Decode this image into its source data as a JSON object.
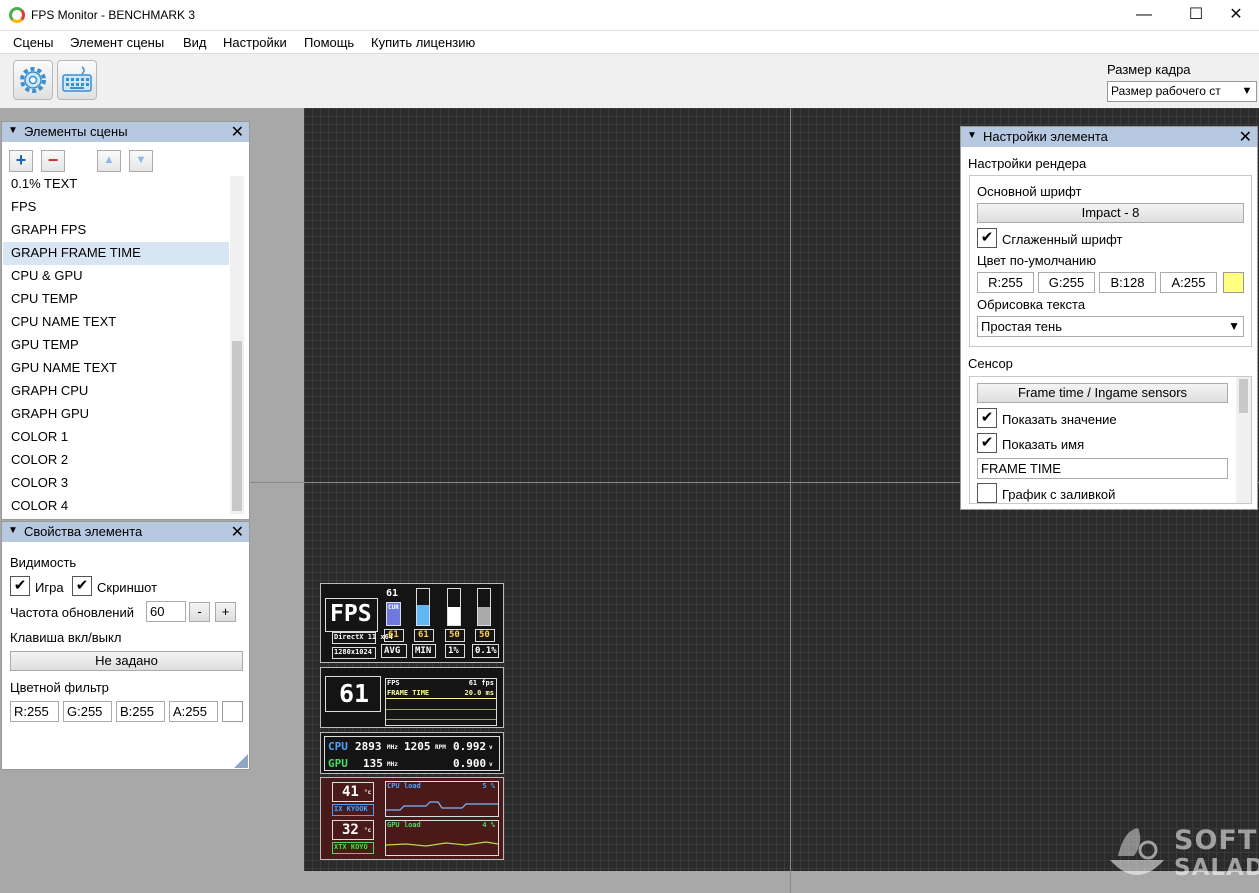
{
  "window": {
    "title": "FPS Monitor - BENCHMARK 3",
    "minimize": "—",
    "maximize": "☐",
    "close": "✕"
  },
  "menu": [
    "Сцены",
    "Элемент сцены",
    "Вид",
    "Настройки",
    "Помощь",
    "Купить лицензию"
  ],
  "toolbar": {
    "frame_size_label": "Размер кадра",
    "frame_size_value": "Размер рабочего ст",
    "settings_icon": "gear-icon",
    "keyboard_icon": "keyboard-icon"
  },
  "scene_elements": {
    "title": "Элементы сцены",
    "items": [
      "0.1% TEXT",
      "FPS",
      "GRAPH FPS",
      "GRAPH FRAME TIME",
      "CPU & GPU",
      "CPU TEMP",
      "CPU NAME TEXT",
      "GPU TEMP",
      "GPU NAME TEXT",
      "GRAPH CPU",
      "GRAPH GPU",
      "COLOR 1",
      "COLOR 2",
      "COLOR 3",
      "COLOR 4"
    ],
    "selected": "GRAPH FRAME TIME"
  },
  "element_props": {
    "title": "Свойства элемента",
    "visibility": "Видимость",
    "game": "Игра",
    "screenshot": "Скриншот",
    "update_rate_label": "Частота обновлений",
    "update_rate": "60",
    "minus": "-",
    "plus": "+",
    "hotkey_label": "Клавиша вкл/выкл",
    "hotkey_value": "Не задано",
    "color_filter": "Цветной фильтр",
    "r": "R:255",
    "g": "G:255",
    "b": "B:255",
    "a": "A:255"
  },
  "element_settings": {
    "title": "Настройки элемента",
    "render_settings": "Настройки рендера",
    "main_font_label": "Основной шрифт",
    "main_font": "Impact - 8",
    "smooth_font": "Сглаженный шрифт",
    "default_color": "Цвет по-умолчанию",
    "r": "R:255",
    "g": "G:255",
    "b": "B:128",
    "a": "A:255",
    "outline_label": "Обрисовка текста",
    "outline_value": "Простая тень",
    "sensor_label": "Сенсор",
    "sensor_value": "Frame time / Ingame sensors",
    "show_value": "Показать значение",
    "show_name": "Показать имя",
    "name_value": "FRAME TIME",
    "filled_graph": "График с заливкой",
    "swatch_color": "#ffff80"
  },
  "osd": {
    "fps_label": "FPS",
    "api": "DirectX 11 x64",
    "resolution": "1280x1024",
    "fps_value": "61",
    "avg": "61",
    "min": "61",
    "p1": "50",
    "p01": "50",
    "avg_label": "AVG",
    "min_label": "MIN",
    "p1_label": "1%",
    "p01_label": "0.1%",
    "cur_label": "CUR",
    "big_fps": "61",
    "graph_fps_label": "FPS",
    "graph_fps_value": "61 fps",
    "graph_ft_label": "FRAME TIME",
    "graph_ft_value": "20.0 ms",
    "cpu_label": "CPU",
    "cpu_mhz": "2893",
    "cpu_mhz_unit": "MHz",
    "fan": "1205",
    "fan_unit": "RPM",
    "cpu_v": "0.992",
    "v_unit": "v",
    "gpu_label": "GPU",
    "gpu_mhz": "135",
    "gpu_mhz_unit": "MHz",
    "gpu_v": "0.900",
    "cpu_temp": "41",
    "gpu_temp": "32",
    "temp_unit": "°c",
    "cpu_name": "IX KYOOK",
    "gpu_name": "XTX KOYO",
    "cpu_load_label": "CPU load",
    "cpu_load_value": "5 %",
    "gpu_load_label": "GPU load",
    "gpu_load_value": "4 %"
  },
  "watermark": {
    "line1": "SOFT",
    "line2": "SALAD"
  }
}
